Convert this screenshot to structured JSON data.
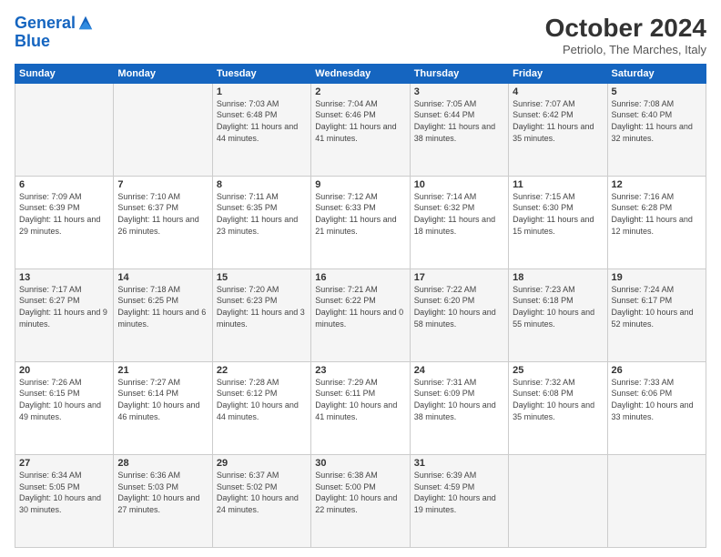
{
  "logo": {
    "line1": "General",
    "line2": "Blue"
  },
  "title": "October 2024",
  "location": "Petriolo, The Marches, Italy",
  "days_header": [
    "Sunday",
    "Monday",
    "Tuesday",
    "Wednesday",
    "Thursday",
    "Friday",
    "Saturday"
  ],
  "weeks": [
    [
      {
        "day": "",
        "content": ""
      },
      {
        "day": "",
        "content": ""
      },
      {
        "day": "1",
        "content": "Sunrise: 7:03 AM\nSunset: 6:48 PM\nDaylight: 11 hours and 44 minutes."
      },
      {
        "day": "2",
        "content": "Sunrise: 7:04 AM\nSunset: 6:46 PM\nDaylight: 11 hours and 41 minutes."
      },
      {
        "day": "3",
        "content": "Sunrise: 7:05 AM\nSunset: 6:44 PM\nDaylight: 11 hours and 38 minutes."
      },
      {
        "day": "4",
        "content": "Sunrise: 7:07 AM\nSunset: 6:42 PM\nDaylight: 11 hours and 35 minutes."
      },
      {
        "day": "5",
        "content": "Sunrise: 7:08 AM\nSunset: 6:40 PM\nDaylight: 11 hours and 32 minutes."
      }
    ],
    [
      {
        "day": "6",
        "content": "Sunrise: 7:09 AM\nSunset: 6:39 PM\nDaylight: 11 hours and 29 minutes."
      },
      {
        "day": "7",
        "content": "Sunrise: 7:10 AM\nSunset: 6:37 PM\nDaylight: 11 hours and 26 minutes."
      },
      {
        "day": "8",
        "content": "Sunrise: 7:11 AM\nSunset: 6:35 PM\nDaylight: 11 hours and 23 minutes."
      },
      {
        "day": "9",
        "content": "Sunrise: 7:12 AM\nSunset: 6:33 PM\nDaylight: 11 hours and 21 minutes."
      },
      {
        "day": "10",
        "content": "Sunrise: 7:14 AM\nSunset: 6:32 PM\nDaylight: 11 hours and 18 minutes."
      },
      {
        "day": "11",
        "content": "Sunrise: 7:15 AM\nSunset: 6:30 PM\nDaylight: 11 hours and 15 minutes."
      },
      {
        "day": "12",
        "content": "Sunrise: 7:16 AM\nSunset: 6:28 PM\nDaylight: 11 hours and 12 minutes."
      }
    ],
    [
      {
        "day": "13",
        "content": "Sunrise: 7:17 AM\nSunset: 6:27 PM\nDaylight: 11 hours and 9 minutes."
      },
      {
        "day": "14",
        "content": "Sunrise: 7:18 AM\nSunset: 6:25 PM\nDaylight: 11 hours and 6 minutes."
      },
      {
        "day": "15",
        "content": "Sunrise: 7:20 AM\nSunset: 6:23 PM\nDaylight: 11 hours and 3 minutes."
      },
      {
        "day": "16",
        "content": "Sunrise: 7:21 AM\nSunset: 6:22 PM\nDaylight: 11 hours and 0 minutes."
      },
      {
        "day": "17",
        "content": "Sunrise: 7:22 AM\nSunset: 6:20 PM\nDaylight: 10 hours and 58 minutes."
      },
      {
        "day": "18",
        "content": "Sunrise: 7:23 AM\nSunset: 6:18 PM\nDaylight: 10 hours and 55 minutes."
      },
      {
        "day": "19",
        "content": "Sunrise: 7:24 AM\nSunset: 6:17 PM\nDaylight: 10 hours and 52 minutes."
      }
    ],
    [
      {
        "day": "20",
        "content": "Sunrise: 7:26 AM\nSunset: 6:15 PM\nDaylight: 10 hours and 49 minutes."
      },
      {
        "day": "21",
        "content": "Sunrise: 7:27 AM\nSunset: 6:14 PM\nDaylight: 10 hours and 46 minutes."
      },
      {
        "day": "22",
        "content": "Sunrise: 7:28 AM\nSunset: 6:12 PM\nDaylight: 10 hours and 44 minutes."
      },
      {
        "day": "23",
        "content": "Sunrise: 7:29 AM\nSunset: 6:11 PM\nDaylight: 10 hours and 41 minutes."
      },
      {
        "day": "24",
        "content": "Sunrise: 7:31 AM\nSunset: 6:09 PM\nDaylight: 10 hours and 38 minutes."
      },
      {
        "day": "25",
        "content": "Sunrise: 7:32 AM\nSunset: 6:08 PM\nDaylight: 10 hours and 35 minutes."
      },
      {
        "day": "26",
        "content": "Sunrise: 7:33 AM\nSunset: 6:06 PM\nDaylight: 10 hours and 33 minutes."
      }
    ],
    [
      {
        "day": "27",
        "content": "Sunrise: 6:34 AM\nSunset: 5:05 PM\nDaylight: 10 hours and 30 minutes."
      },
      {
        "day": "28",
        "content": "Sunrise: 6:36 AM\nSunset: 5:03 PM\nDaylight: 10 hours and 27 minutes."
      },
      {
        "day": "29",
        "content": "Sunrise: 6:37 AM\nSunset: 5:02 PM\nDaylight: 10 hours and 24 minutes."
      },
      {
        "day": "30",
        "content": "Sunrise: 6:38 AM\nSunset: 5:00 PM\nDaylight: 10 hours and 22 minutes."
      },
      {
        "day": "31",
        "content": "Sunrise: 6:39 AM\nSunset: 4:59 PM\nDaylight: 10 hours and 19 minutes."
      },
      {
        "day": "",
        "content": ""
      },
      {
        "day": "",
        "content": ""
      }
    ]
  ]
}
